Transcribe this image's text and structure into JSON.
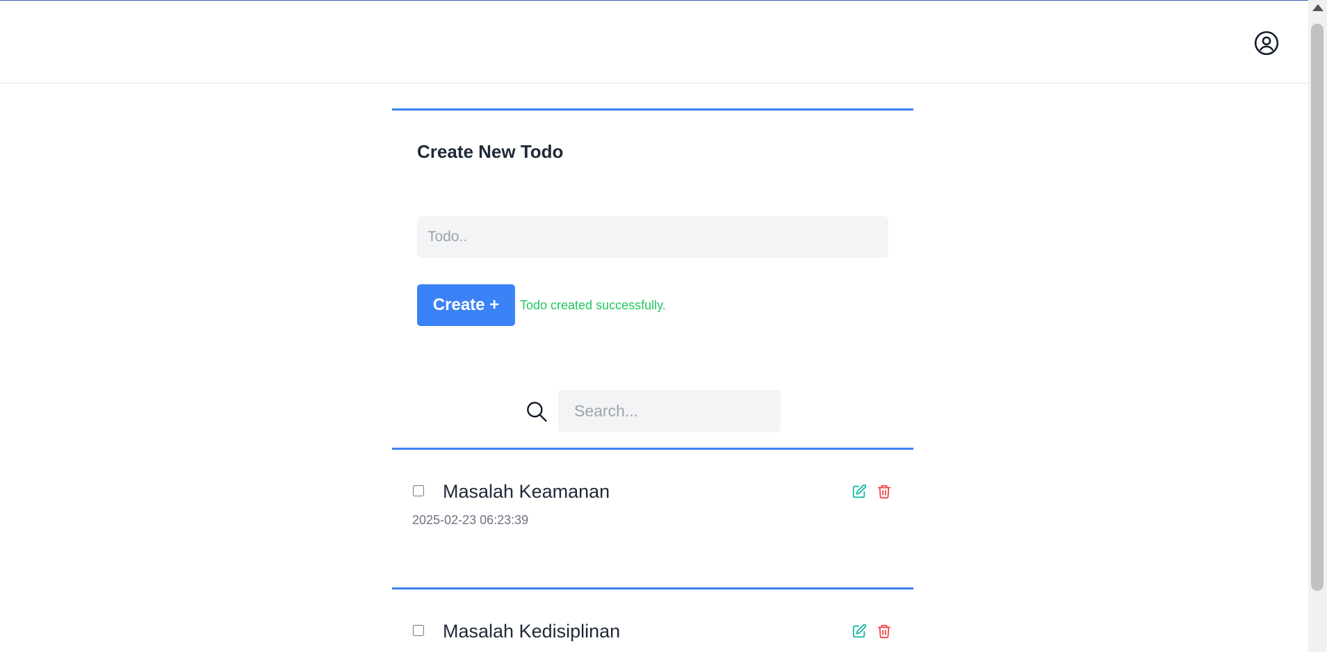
{
  "navbar": {
    "profile_icon": "user-circle-icon"
  },
  "create_form": {
    "title": "Create New Todo",
    "todo_input_value": "",
    "todo_input_placeholder": "Todo..",
    "create_button_label": "Create +",
    "success_message": "Todo created successfully."
  },
  "search": {
    "icon": "search-icon",
    "value": "",
    "placeholder": "Search..."
  },
  "todos": [
    {
      "text": "Masalah Keamanan",
      "date": "2025-02-23 06:23:39",
      "checked": false
    },
    {
      "text": "Masalah Kedisiplinan",
      "date": "",
      "checked": false
    }
  ],
  "colors": {
    "accent": "#3b82f6",
    "success": "#22c55e",
    "edit": "#14b8a6",
    "delete": "#ef4444"
  }
}
